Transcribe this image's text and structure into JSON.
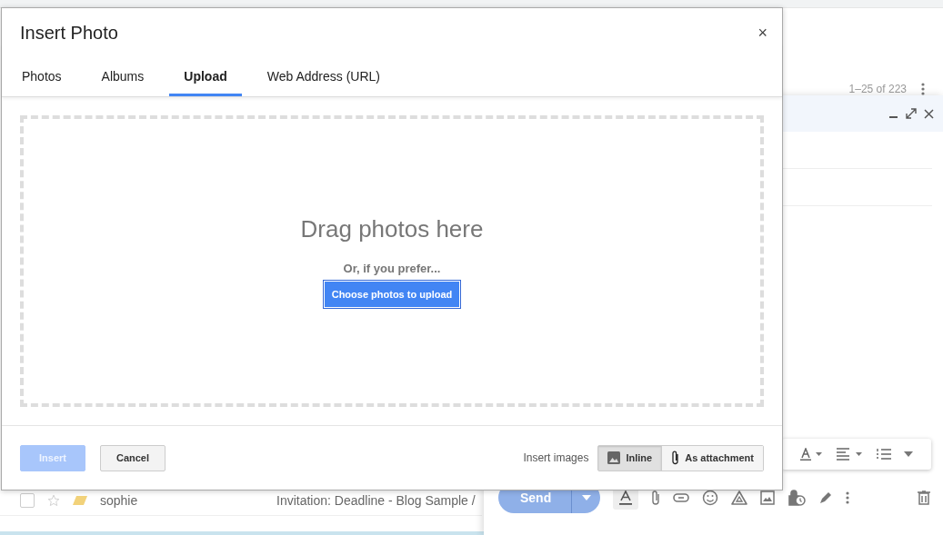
{
  "inbox": {
    "pager": "1–25 of 223",
    "rows": [
      {
        "sender": "sophie",
        "subject": "Invitation: Deadline - Blog Sample /",
        "checked": false,
        "starred": false
      }
    ]
  },
  "compose": {
    "send_label": "Send"
  },
  "dialog": {
    "title": "Insert Photo",
    "close": "×",
    "tabs": [
      {
        "label": "Photos",
        "selected": false
      },
      {
        "label": "Albums",
        "selected": false
      },
      {
        "label": "Upload",
        "selected": true
      },
      {
        "label": "Web Address (URL)",
        "selected": false
      }
    ],
    "drop_zone": {
      "heading": "Drag photos here",
      "hint": "Or, if you prefer...",
      "button": "Choose photos to upload"
    },
    "buttons": [
      {
        "label": "Insert",
        "disabled": true
      },
      {
        "label": "Cancel",
        "disabled": false
      }
    ],
    "insert_images": {
      "label": "Insert images",
      "options": [
        {
          "label": "Inline",
          "kind": "inline",
          "selected": true
        },
        {
          "label": "As attachment",
          "kind": "attachment",
          "selected": false
        }
      ]
    }
  }
}
